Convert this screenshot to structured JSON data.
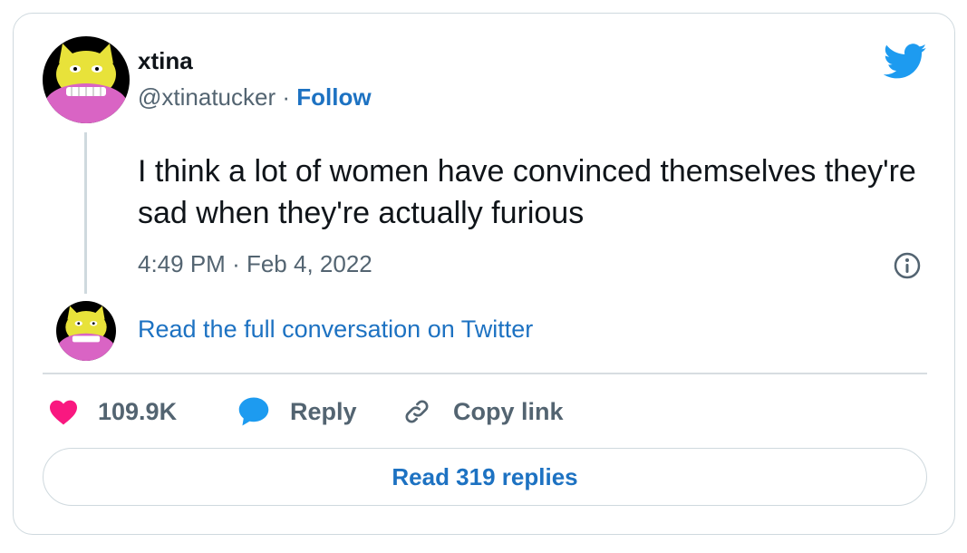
{
  "tweet": {
    "author_name": "xtina",
    "handle": "@xtinatucker",
    "separator": "·",
    "follow_label": "Follow",
    "text": "I think a lot of women have convinced themselves they're sad when they're actually furious",
    "time": "4:49 PM",
    "date": "Feb 4, 2022",
    "read_full_label": "Read the full conversation on Twitter",
    "like_count": "109.9K",
    "reply_label": "Reply",
    "copy_link_label": "Copy link",
    "read_replies_label": "Read 319 replies"
  },
  "icons": {
    "brand": "twitter-bird-icon",
    "like": "heart-icon",
    "reply": "speech-bubble-icon",
    "copy": "link-icon",
    "info": "info-icon"
  },
  "colors": {
    "link_blue": "#1d72c2",
    "twitter_blue": "#1d9bf0",
    "heart_pink": "#f91880",
    "muted_text": "#536471",
    "border": "#cfd9de"
  }
}
